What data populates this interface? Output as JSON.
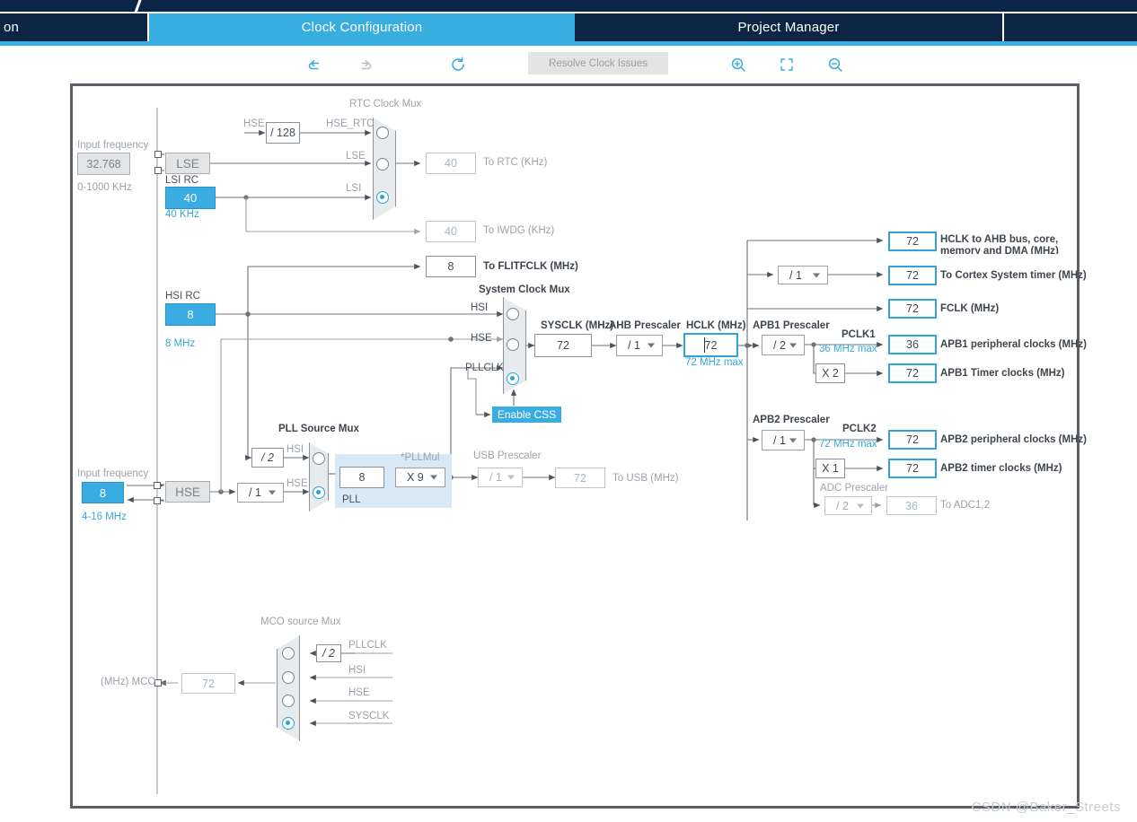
{
  "window": {
    "tabs": [
      {
        "label": "on",
        "state": "inactive",
        "truncated": true
      },
      {
        "label": "Clock Configuration",
        "state": "active"
      },
      {
        "label": "Project Manager",
        "state": "inactive"
      },
      {
        "label": "",
        "state": "inactive"
      }
    ],
    "accent_color": "#38ade0",
    "tab_dark_color": "#0d2545"
  },
  "toolbar": {
    "undo_icon": "undo-icon",
    "redo_icon": "redo-icon",
    "refresh_icon": "refresh-icon",
    "resolve_label": "Resolve Clock Issues",
    "resolve_enabled": false,
    "zoom_in_icon": "zoom-in-icon",
    "fit_icon": "fit-to-screen-icon",
    "zoom_out_icon": "zoom-out-icon"
  },
  "watermark": "CSDN @Baker_Streets",
  "chart_data": {
    "type": "diagram",
    "title": "Clock Configuration",
    "device_family": "STM32F1",
    "nodes": {
      "lse_input_frequency_label": "Input frequency",
      "lse_input_frequency_value": "32.768",
      "lse_input_frequency_range": "0-1000 KHz",
      "lse_label": "LSE",
      "lsi_rc_label": "LSI RC",
      "lsi_value": "40",
      "lsi_unit": "40 KHz",
      "hse_div128_label": "/ 128",
      "hse_div128_in_label": "HSE",
      "hse_rtc_label": "HSE_RTC",
      "rtc_clock_mux_label": "RTC Clock Mux",
      "rtc_mux_inputs": [
        "HSE_RTC",
        "LSE",
        "LSI"
      ],
      "rtc_mux_selected": "LSI",
      "to_rtc_value": "40",
      "to_rtc_label": "To RTC (KHz)",
      "to_iwdg_value": "40",
      "to_iwdg_label": "To IWDG (KHz)",
      "to_flitfclk_value": "8",
      "to_flitfclk_label": "To FLITFCLK (MHz)",
      "hsi_rc_label": "HSI RC",
      "hsi_value": "8",
      "hsi_unit": "8 MHz",
      "hse_input_frequency_label": "Input frequency",
      "hse_input_frequency_value": "8",
      "hse_input_frequency_range": "4-16 MHz",
      "hse_label": "HSE",
      "hse_div_value": "/ 1",
      "pll_src_hsi_div2": "/ 2",
      "pll_source_mux_label": "PLL Source Mux",
      "pll_mux_inputs": [
        "HSI",
        "HSE"
      ],
      "pll_mux_selected": "HSE",
      "pll_input_value": "8",
      "pllmul_label": "*PLLMul",
      "pllmul_value": "X 9",
      "pll_label": "PLL",
      "system_clock_mux_label": "System Clock Mux",
      "sysclk_mux_inputs": [
        "HSI",
        "HSE",
        "PLLCLK"
      ],
      "sysclk_mux_selected": "PLLCLK",
      "enable_css_label": "Enable CSS",
      "sysclk_label": "SYSCLK (MHz)",
      "sysclk_value": "72",
      "ahb_prescaler_label": "AHB Prescaler",
      "ahb_prescaler_value": "/ 1",
      "hclk_label": "HCLK (MHz)",
      "hclk_value": "72",
      "hclk_max": "72 MHz max",
      "usb_prescaler_label": "USB Prescaler",
      "usb_prescaler_value": "/ 1",
      "to_usb_value": "72",
      "to_usb_label": "To USB (MHz)",
      "hclk_ahb_value": "72",
      "hclk_ahb_label": "HCLK to AHB bus, core, memory and DMA (MHz)",
      "cortex_div_value": "/ 1",
      "cortex_timer_value": "72",
      "cortex_timer_label": "To Cortex System timer (MHz)",
      "fclk_value": "72",
      "fclk_label": "FCLK (MHz)",
      "apb1_prescaler_label": "APB1 Prescaler",
      "apb1_prescaler_value": "/ 2",
      "pclk1_label": "PCLK1",
      "pclk1_max": "36 MHz max",
      "apb1_periph_value": "36",
      "apb1_periph_label": "APB1 peripheral clocks (MHz)",
      "apb1_timer_mul": "X 2",
      "apb1_timer_value": "72",
      "apb1_timer_label": "APB1 Timer clocks (MHz)",
      "apb2_prescaler_label": "APB2 Prescaler",
      "apb2_prescaler_value": "/ 1",
      "pclk2_label": "PCLK2",
      "pclk2_max": "72 MHz max",
      "apb2_periph_value": "72",
      "apb2_periph_label": "APB2 peripheral clocks (MHz)",
      "apb2_timer_mul": "X 1",
      "apb2_timer_value": "72",
      "apb2_timer_label": "APB2 timer clocks (MHz)",
      "adc_prescaler_label": "ADC Prescaler",
      "adc_prescaler_value": "/ 2",
      "to_adc_value": "36",
      "to_adc_label": "To ADC1,2",
      "mco_source_mux_label": "MCO source Mux",
      "mco_pllclk_div2": "/ 2",
      "mco_mux_inputs": [
        "PLLCLK",
        "HSI",
        "HSE",
        "SYSCLK"
      ],
      "mco_mux_selected": "SYSCLK",
      "mco_value": "72",
      "mco_label": "(MHz) MCO"
    }
  }
}
